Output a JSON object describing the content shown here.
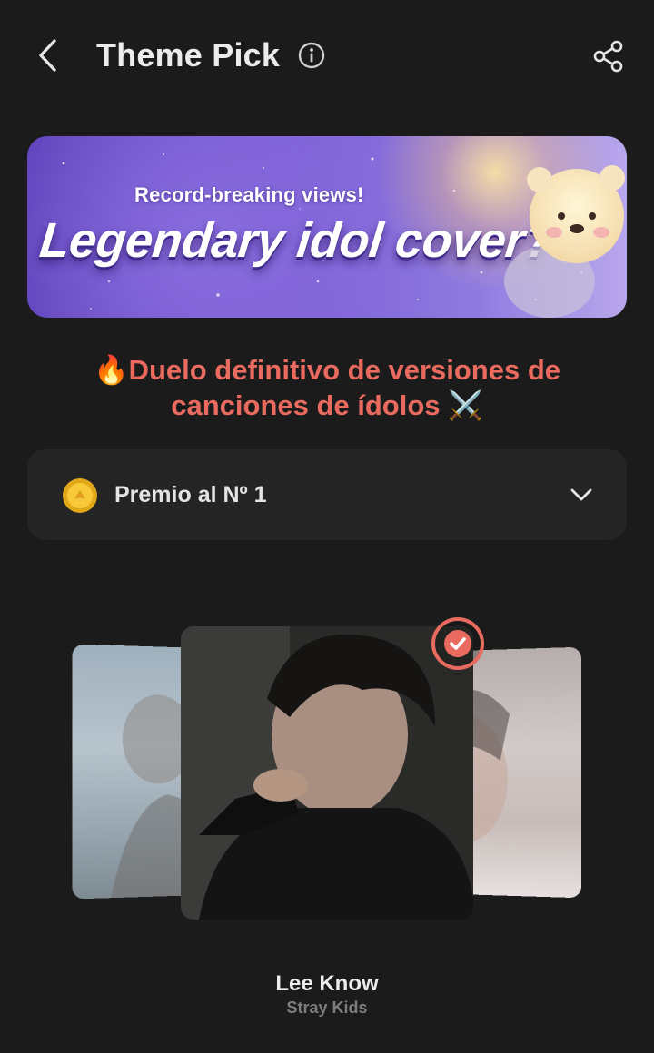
{
  "header": {
    "title": "Theme Pick",
    "back_icon": "chevron-left-icon",
    "info_icon": "info-icon",
    "share_icon": "share-icon"
  },
  "banner": {
    "subtitle": "Record-breaking views!",
    "title": "Legendary idol cover?"
  },
  "headline": {
    "line1": "🔥Duelo definitivo de versiones de",
    "line2": "canciones de ídolos ⚔️"
  },
  "prize": {
    "icon": "coin-icon",
    "label": "Premio al Nº 1",
    "chevron_icon": "chevron-down-icon"
  },
  "carousel": {
    "selected_icon": "check-circle-icon",
    "selected": {
      "name": "Lee Know",
      "group": "Stray Kids"
    }
  },
  "colors": {
    "background": "#1b1b1b",
    "accent": "#e96a5e",
    "card": "#242424"
  }
}
